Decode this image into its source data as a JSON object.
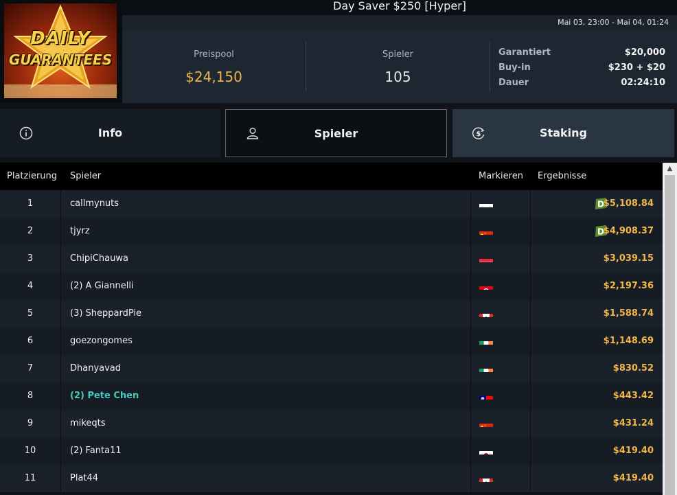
{
  "header": {
    "title": "Day Saver $250 [Hyper]",
    "dates": "Mai 03, 23:00 - Mai 04, 01:24",
    "logo_text": [
      "DAILY",
      "GUARANTEES"
    ]
  },
  "stats": {
    "prizepool_label": "Preispool",
    "prizepool_value": "$24,150",
    "players_label": "Spieler",
    "players_value": "105",
    "guaranteed_label": "Garantiert",
    "guaranteed_value": "$20,000",
    "buyin_label": "Buy-in",
    "buyin_value": "$230 + $20",
    "duration_label": "Dauer",
    "duration_value": "02:24:10"
  },
  "tabs": [
    {
      "label": "Info",
      "icon": "info-icon"
    },
    {
      "label": "Spieler",
      "icon": "user-icon"
    },
    {
      "label": "Staking",
      "icon": "dollar-icon"
    }
  ],
  "table": {
    "headers": [
      "Platzierung",
      "Spieler",
      "Markieren",
      "Ergebnisse"
    ],
    "rows": [
      {
        "place": "1",
        "player": "callmynuts",
        "flag": "cyprus",
        "result": "$5,108.84",
        "badge": true
      },
      {
        "place": "2",
        "player": "tjyrz",
        "flag": "china",
        "result": "$4,908.37",
        "badge": true
      },
      {
        "place": "3",
        "player": "ChipiChauwa",
        "flag": "austria",
        "result": "$3,039.15"
      },
      {
        "place": "4",
        "player": "(2) A Giannelli",
        "flag": "tunisia",
        "result": "$2,197.36"
      },
      {
        "place": "5",
        "player": "(3) SheppardPie",
        "flag": "canada",
        "result": "$1,588.74"
      },
      {
        "place": "6",
        "player": "goezongomes",
        "flag": "ireland",
        "result": "$1,148.69"
      },
      {
        "place": "7",
        "player": "Dhanyavad",
        "flag": "ireland",
        "result": "$830.52"
      },
      {
        "place": "8",
        "player": "(2) Pete Chen",
        "flag": "taiwan",
        "result": "$443.42",
        "highlight": true
      },
      {
        "place": "9",
        "player": "mikeqts",
        "flag": "china",
        "result": "$431.24"
      },
      {
        "place": "10",
        "player": "(2) Fanta11",
        "flag": "japan",
        "result": "$419.40"
      },
      {
        "place": "11",
        "player": "Plat44",
        "flag": "canada",
        "result": "$419.40"
      }
    ]
  },
  "colors": {
    "accent_gold": "#f0b64b",
    "highlight_teal": "#4ec9c2",
    "badge_green": "#5b8f2b"
  }
}
